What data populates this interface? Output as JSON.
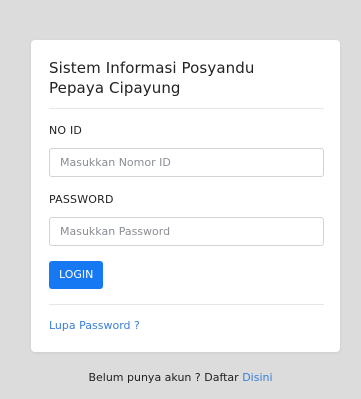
{
  "card": {
    "title_line1": "Sistem Informasi Posyandu",
    "title_line2": "Pepaya Cipayung"
  },
  "form": {
    "noid_label": "NO ID",
    "noid_placeholder": "Masukkan Nomor ID",
    "noid_value": "",
    "password_label": "PASSWORD",
    "password_placeholder": "Masukkan Password",
    "password_value": "",
    "login_button": "LOGIN",
    "forgot_link": "Lupa Password ?"
  },
  "footer": {
    "text": "Belum punya akun ? Daftar",
    "link": "Disini"
  },
  "colors": {
    "background": "#dcdcdc",
    "card": "#ffffff",
    "primary_button": "#1678f2",
    "link": "#3a7fd6"
  }
}
